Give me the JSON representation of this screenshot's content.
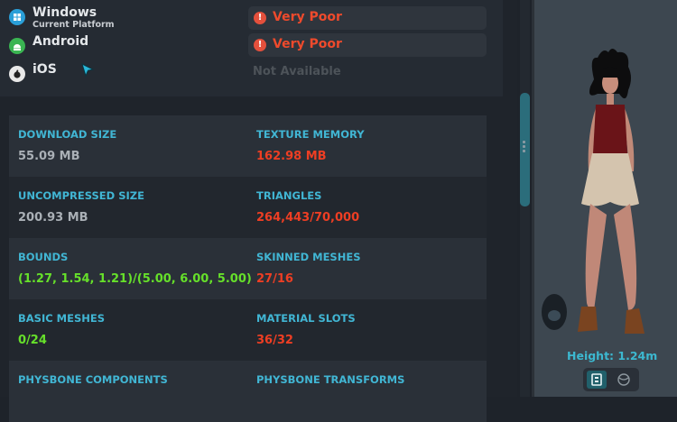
{
  "platforms": [
    {
      "name": "Windows",
      "subtitle": "Current Platform",
      "icon": "windows-icon",
      "color": "#2a9fd8",
      "rating": "Very Poor"
    },
    {
      "name": "Android",
      "icon": "android-icon",
      "color": "#3ab552",
      "rating": "Very Poor"
    },
    {
      "name": "iOS",
      "icon": "apple-icon",
      "color": "#e8e8e8",
      "status": "Not Available"
    }
  ],
  "stats": [
    {
      "label": "DOWNLOAD SIZE",
      "value": "55.09 MB"
    },
    {
      "label": "TEXTURE MEMORY",
      "value": "162.98 MB"
    },
    {
      "label": "UNCOMPRESSED SIZE",
      "value": "200.93 MB"
    },
    {
      "label": "TRIANGLES",
      "value": "264,443/70,000"
    },
    {
      "label": "BOUNDS",
      "value": "(1.27, 1.54, 1.21)/(5.00, 6.00, 5.00)"
    },
    {
      "label": "SKINNED MESHES",
      "value": "27/16"
    },
    {
      "label": "BASIC MESHES",
      "value": "0/24"
    },
    {
      "label": "MATERIAL SLOTS",
      "value": "36/32"
    },
    {
      "label": "PHYSBONE COMPONENTS"
    },
    {
      "label": "PHYSBONE TRANSFORMS"
    }
  ],
  "preview": {
    "height_label": "Height: 1.24m"
  },
  "colors": {
    "accent": "#41b6d4",
    "bad": "#ee3e23",
    "good": "#66e02a"
  }
}
